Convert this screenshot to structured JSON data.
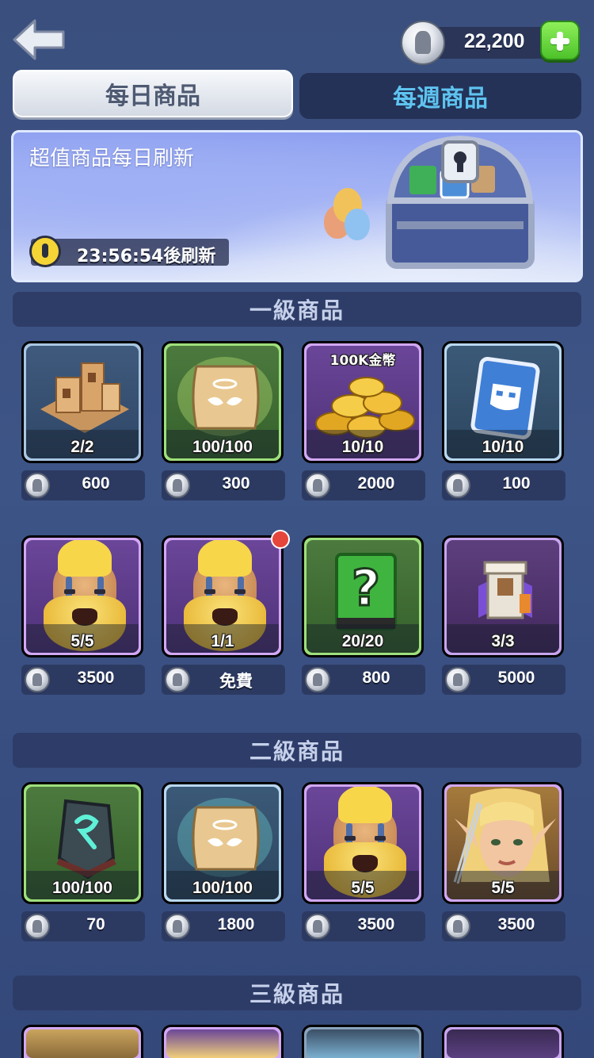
{
  "header": {
    "currency_value": "22,200"
  },
  "tabs": {
    "daily": "每日商品",
    "weekly": "每週商品"
  },
  "banner": {
    "title": "超值商品每日刷新",
    "timer": "23:56:54後刷新"
  },
  "sections": {
    "tier1": "一級商品",
    "tier2": "二級商品",
    "tier3": "三級商品"
  },
  "tier1_row1": [
    {
      "item": "building",
      "count": "2/2",
      "price": "600"
    },
    {
      "item": "scroll",
      "count": "100/100",
      "price": "300"
    },
    {
      "item": "gold-coins",
      "label": "100K金幣",
      "count": "10/10",
      "price": "2000"
    },
    {
      "item": "card",
      "count": "10/10",
      "price": "100"
    }
  ],
  "tier1_row2": [
    {
      "item": "hero-dwarf",
      "count": "5/5",
      "price": "3500"
    },
    {
      "item": "hero-dwarf",
      "count": "1/1",
      "price": "免費"
    },
    {
      "item": "mystery-book",
      "count": "20/20",
      "price": "800"
    },
    {
      "item": "tower",
      "count": "3/3",
      "price": "5000"
    }
  ],
  "tier2_row1": [
    {
      "item": "rune-stone",
      "count": "100/100",
      "price": "70"
    },
    {
      "item": "scroll",
      "count": "100/100",
      "price": "1800"
    },
    {
      "item": "hero-dwarf",
      "count": "5/5",
      "price": "3500"
    },
    {
      "item": "hero-elf",
      "count": "5/5",
      "price": "3500"
    }
  ],
  "colors": {
    "background": "#3a4f7e",
    "weekly_tab_text": "#5ec3ef",
    "plus_button": "#4dc22a",
    "notification_dot": "#e6453b"
  }
}
